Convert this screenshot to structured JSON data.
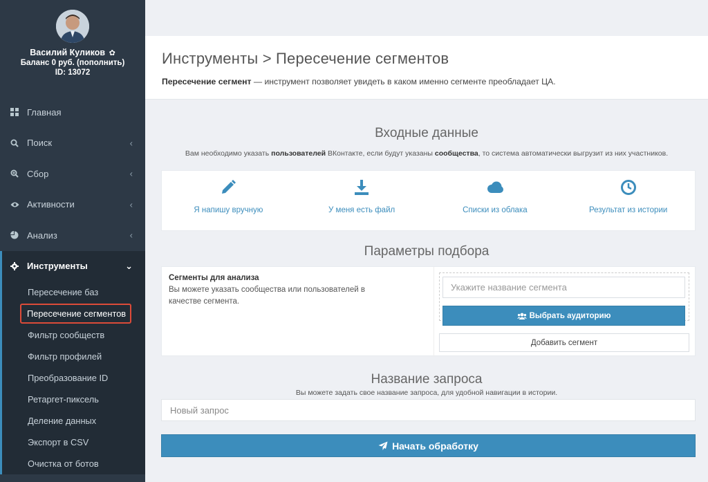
{
  "profile": {
    "name": "Василий Куликов",
    "balance": "Баланс 0 руб. (пополнить)",
    "id_line": "ID: 13072"
  },
  "sidebar": {
    "items": [
      {
        "label": "Главная",
        "icon": "dashboard-icon"
      },
      {
        "label": "Поиск",
        "icon": "search-icon"
      },
      {
        "label": "Сбор",
        "icon": "zoom-icon"
      },
      {
        "label": "Активности",
        "icon": "eye-icon"
      },
      {
        "label": "Анализ",
        "icon": "pie-chart-icon"
      },
      {
        "label": "Инструменты",
        "icon": "gear-icon"
      }
    ],
    "submenu": [
      "Пересечение баз",
      "Пересечение сегментов",
      "Фильтр сообществ",
      "Фильтр профилей",
      "Преобразование ID",
      "Ретаргет-пиксель",
      "Деление данных",
      "Экспорт в CSV",
      "Очистка от ботов"
    ]
  },
  "header": {
    "title": "Инструменты > Пересечение сегментов",
    "desc_bold": "Пересечение сегмент",
    "desc_rest": " — инструмент позволяет увидеть в каком именно сегменте преобладает ЦА."
  },
  "input_section": {
    "title": "Входные данные",
    "note_1": "Вам необходимо указать ",
    "note_b1": "пользователей",
    "note_2": " ВКонтакте, если будут указаны ",
    "note_b2": "сообщества",
    "note_3": ", то система автоматически выгрузит из них участников.",
    "sources": [
      {
        "label": "Я напишу вручную",
        "icon": "pencil-icon"
      },
      {
        "label": "У меня есть файл",
        "icon": "download-icon"
      },
      {
        "label": "Списки из облака",
        "icon": "cloud-icon"
      },
      {
        "label": "Результат из истории",
        "icon": "clock-icon"
      }
    ]
  },
  "params_section": {
    "title": "Параметры подбора",
    "segments_title": "Сегменты для анализа",
    "segments_desc": "Вы можете указать сообщества или пользователей в качестве сегмента.",
    "segment_placeholder": "Укажите название сегмента",
    "choose_audience": "Выбрать аудиторию",
    "add_segment": "Добавить сегмент"
  },
  "query_section": {
    "title": "Название запроса",
    "note": "Вы можете задать свое название запроса, для удобной навигации в истории.",
    "placeholder": "Новый запрос"
  },
  "start_button": "Начать обработку",
  "colors": {
    "sidebar": "#2d3946",
    "accent": "#3c8dbc",
    "highlight": "#dd4b39"
  }
}
